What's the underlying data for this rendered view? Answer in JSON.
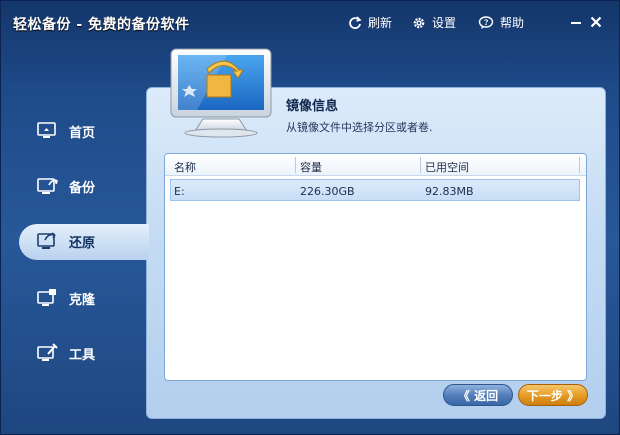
{
  "app": {
    "title": "轻松备份 - 免费的备份软件"
  },
  "toolbar": {
    "refresh_label": "刷新",
    "settings_label": "设置",
    "help_label": "帮助"
  },
  "sidebar": {
    "items": [
      {
        "label": "首页",
        "icon": "home-monitor-icon"
      },
      {
        "label": "备份",
        "icon": "backup-monitor-icon"
      },
      {
        "label": "还原",
        "icon": "restore-monitor-icon",
        "active": true
      },
      {
        "label": "克隆",
        "icon": "clone-monitor-icon"
      },
      {
        "label": "工具",
        "icon": "tools-monitor-icon"
      }
    ]
  },
  "main": {
    "section_title": "镜像信息",
    "section_desc": "从镜像文件中选择分区或者卷.",
    "table": {
      "columns": [
        "名称",
        "容量",
        "已用空间"
      ],
      "rows": [
        {
          "name": "E:",
          "capacity": "226.30GB",
          "used": "92.83MB"
        }
      ]
    }
  },
  "buttons": {
    "back_label": "《 返回",
    "next_label": "下一步 》"
  },
  "colors": {
    "accent": "#1e4a88",
    "next_button": "#e39a22",
    "back_button": "#4f7bb8"
  }
}
